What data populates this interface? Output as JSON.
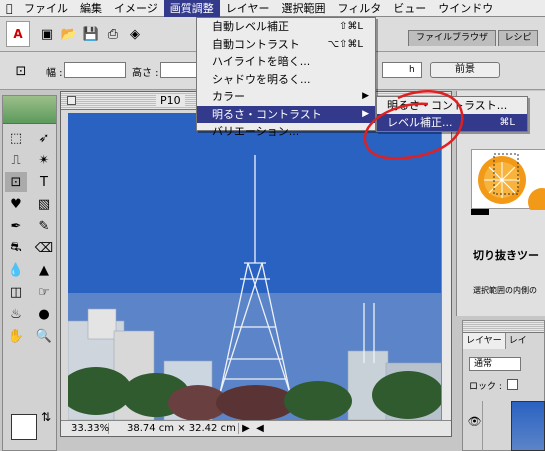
{
  "menubar": {
    "items": [
      "ファイル",
      "編集",
      "イメージ",
      "画質調整",
      "レイヤー",
      "選択範囲",
      "フィルタ",
      "ビュー",
      "ウインドウ"
    ]
  },
  "options": {
    "width_label": "幅 :",
    "height_label": "高さ :",
    "tab_file_browser": "ファイルブラウザ",
    "tab_recipe": "レシピ",
    "front_image_button": "前景",
    "resolution_unit": "h"
  },
  "document": {
    "title": "P10",
    "zoom": "33.33%",
    "doc_size": "38.74 cm × 32.42 cm"
  },
  "adjust_menu": {
    "items": [
      {
        "label": "自動レベル補正",
        "shortcut": "⇧⌘L"
      },
      {
        "label": "自動コントラスト",
        "shortcut": "⌥⇧⌘L"
      },
      {
        "label": "ハイライトを暗く...",
        "shortcut": ""
      },
      {
        "label": "シャドウを明るく...",
        "shortcut": ""
      },
      {
        "label": "カラー",
        "shortcut": ""
      },
      {
        "label": "明るさ・コントラスト",
        "shortcut": ""
      },
      {
        "label": "バリエーション...",
        "shortcut": ""
      }
    ]
  },
  "submenu": {
    "items": [
      {
        "label": "明るさ・コントラスト...",
        "shortcut": ""
      },
      {
        "label": "レベル補正...",
        "shortcut": "⌘L"
      }
    ]
  },
  "hint_panel": {
    "title": "切り抜きツー",
    "desc": "選択範囲の内側の"
  },
  "layers_panel": {
    "tab1": "レイヤー",
    "tab2": "レイ",
    "blend_mode": "通常",
    "lock_label": "ロック :"
  },
  "colors": {
    "highlight": "#333a8c",
    "annotation_circle": "#e02020"
  }
}
